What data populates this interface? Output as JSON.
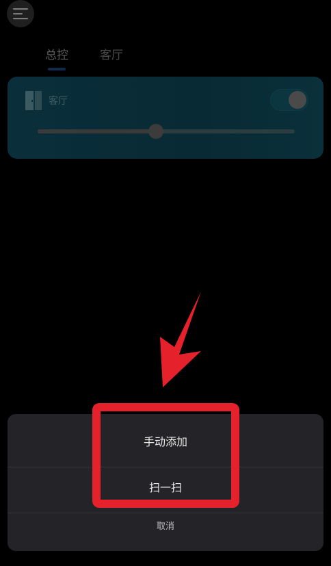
{
  "header": {
    "menu_icon": "menu-icon"
  },
  "tabs": [
    {
      "label": "总控",
      "active": true
    },
    {
      "label": "客厅",
      "active": false
    }
  ],
  "device_card": {
    "icon": "door-icon",
    "name": "客厅",
    "toggle_on": true,
    "slider_value": 0.46
  },
  "action_sheet": {
    "items": [
      {
        "label": "手动添加"
      },
      {
        "label": "扫一扫"
      }
    ],
    "cancel": "取消"
  },
  "annotations": {
    "highlight_color": "#e5212b",
    "arrow_color": "#e5212b"
  }
}
